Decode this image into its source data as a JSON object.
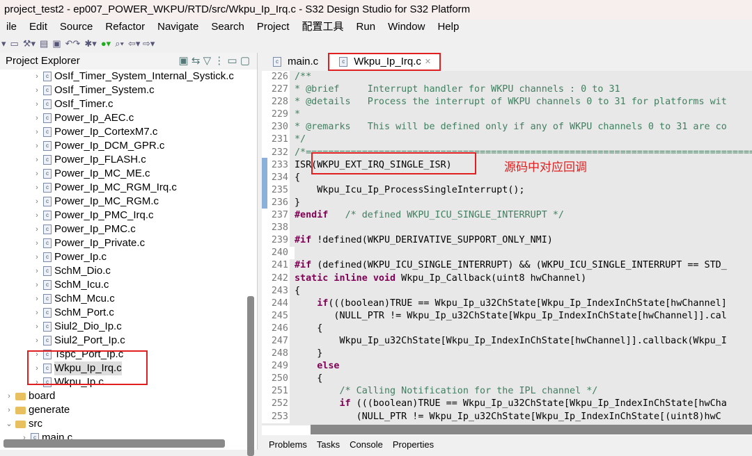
{
  "window": {
    "title": "project_test2 - ep007_POWER_WKPU/RTD/src/Wkpu_Ip_Irq.c - S32 Design Studio for S32 Platform"
  },
  "menu": [
    "ile",
    "Edit",
    "Source",
    "Refactor",
    "Navigate",
    "Search",
    "Project",
    "配置工具",
    "Run",
    "Window",
    "Help"
  ],
  "explorer": {
    "title": "Project Explorer",
    "files": [
      "OsIf_Timer_System_Internal_Systick.c",
      "OsIf_Timer_System.c",
      "OsIf_Timer.c",
      "Power_Ip_AEC.c",
      "Power_Ip_CortexM7.c",
      "Power_Ip_DCM_GPR.c",
      "Power_Ip_FLASH.c",
      "Power_Ip_MC_ME.c",
      "Power_Ip_MC_RGM_Irq.c",
      "Power_Ip_MC_RGM.c",
      "Power_Ip_PMC_Irq.c",
      "Power_Ip_PMC.c",
      "Power_Ip_Private.c",
      "Power_Ip.c",
      "SchM_Dio.c",
      "SchM_Icu.c",
      "SchM_Mcu.c",
      "SchM_Port.c",
      "Siul2_Dio_Ip.c",
      "Siul2_Port_Ip.c",
      "Tspc_Port_Ip.c",
      "Wkpu_Ip_Irq.c",
      "Wkpu_Ip.c"
    ],
    "folders": [
      "board",
      "generate",
      "src"
    ],
    "partial": "main.c"
  },
  "tabs": [
    {
      "label": "main.c"
    },
    {
      "label": "Wkpu_Ip_Irq.c",
      "active": true
    }
  ],
  "code": [
    {
      "n": "226",
      "t": "/**",
      "c": "cm"
    },
    {
      "n": "227",
      "t": "* @brief     Interrupt handler for WKPU channels : 0 to 31",
      "c": "cm"
    },
    {
      "n": "228",
      "t": "* @details   Process the interrupt of WKPU channels 0 to 31 for platforms wit",
      "c": "cm"
    },
    {
      "n": "229",
      "t": "*",
      "c": "cm"
    },
    {
      "n": "230",
      "t": "* @remarks   This will be defined only if any of WKPU channels 0 to 31 are co",
      "c": "cm"
    },
    {
      "n": "231",
      "t": "*/",
      "c": "cm"
    },
    {
      "n": "232",
      "t": "/*================================================================================",
      "c": "cm"
    },
    {
      "n": "233",
      "t": "ISR(WKPU_EXT_IRQ_SINGLE_ISR)",
      "c": ""
    },
    {
      "n": "234",
      "t": "{",
      "c": ""
    },
    {
      "n": "235",
      "t": "    Wkpu_Icu_Ip_ProcessSingleInterrupt();",
      "c": ""
    },
    {
      "n": "236",
      "t": "}",
      "c": ""
    },
    {
      "n": "237",
      "t": "#endif   /* defined WKPU_ICU_SINGLE_INTERRUPT */",
      "c": "kwcm"
    },
    {
      "n": "238",
      "t": "",
      "c": ""
    },
    {
      "n": "239",
      "t": "#if !defined(WKPU_DERIVATIVE_SUPPORT_ONLY_NMI)",
      "c": "kwif"
    },
    {
      "n": "240",
      "t": "",
      "c": "cur"
    },
    {
      "n": "241",
      "t": "#if (defined(WKPU_ICU_SINGLE_INTERRUPT) && (WKPU_ICU_SINGLE_INTERRUPT == STD_",
      "c": "kwif"
    },
    {
      "n": "242",
      "t": "static inline void Wkpu_Ip_Callback(uint8 hwChannel)",
      "c": "kw3"
    },
    {
      "n": "243",
      "t": "{",
      "c": ""
    },
    {
      "n": "244",
      "t": "    if(((boolean)TRUE == Wkpu_Ip_u32ChState[Wkpu_Ip_IndexInChState[hwChannel]",
      "c": "if"
    },
    {
      "n": "245",
      "t": "       (NULL_PTR != Wkpu_Ip_u32ChState[Wkpu_Ip_IndexInChState[hwChannel]].cal",
      "c": ""
    },
    {
      "n": "246",
      "t": "    {",
      "c": ""
    },
    {
      "n": "247",
      "t": "        Wkpu_Ip_u32ChState[Wkpu_Ip_IndexInChState[hwChannel]].callback(Wkpu_I",
      "c": ""
    },
    {
      "n": "248",
      "t": "    }",
      "c": ""
    },
    {
      "n": "249",
      "t": "    else",
      "c": "else"
    },
    {
      "n": "250",
      "t": "    {",
      "c": ""
    },
    {
      "n": "251",
      "t": "        /* Calling Notification for the IPL channel */",
      "c": "cm"
    },
    {
      "n": "252",
      "t": "        if (((boolean)TRUE == Wkpu_Ip_u32ChState[Wkpu_Ip_IndexInChState[hwCha",
      "c": "if"
    },
    {
      "n": "253",
      "t": "           (NULL_PTR != Wkpu_Ip_u32ChState[Wkpu_Ip_IndexInChState[(uint8)hwC",
      "c": ""
    }
  ],
  "annotation": "源码中对应回调",
  "bottom_tabs": [
    "Problems",
    "Tasks",
    "Console",
    "Properties"
  ],
  "colors": {
    "highlight": "#e02020",
    "comment": "#3f7f5f",
    "keyword": "#7f0055"
  }
}
